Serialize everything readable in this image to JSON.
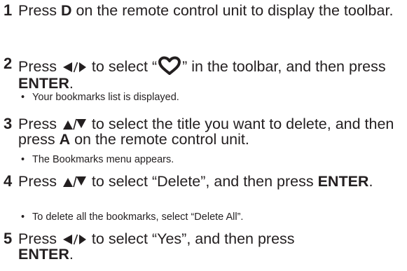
{
  "steps": [
    {
      "number": "1",
      "t1": "Press ",
      "k1": "D",
      "t2": " on the remote control unit to display the toolbar."
    },
    {
      "number": "2",
      "t1": "Press ",
      "t2": " to select “",
      "t3": "” in the toolbar, and then press ",
      "k1": "ENTER",
      "t4": ".",
      "sub": "Your bookmarks list is displayed.",
      "icon": "heart-icon"
    },
    {
      "number": "3",
      "t1": "Press ",
      "t2": " to select the title you want to delete, and then press ",
      "k1": "A",
      "t3": " on the remote control unit.",
      "sub": "The Bookmarks menu appears."
    },
    {
      "number": "4",
      "t1": "Press ",
      "t2": " to select “Delete”, and then press ",
      "k1": "ENTER",
      "t3": ".",
      "sub": "To delete all the bookmarks, select “Delete All”."
    },
    {
      "number": "5",
      "t1": "Press ",
      "t2": " to select “Yes”, and then press ",
      "k1": "ENTER",
      "t3": "."
    }
  ],
  "bullet": "•",
  "colors": {
    "text": "#231f20"
  }
}
